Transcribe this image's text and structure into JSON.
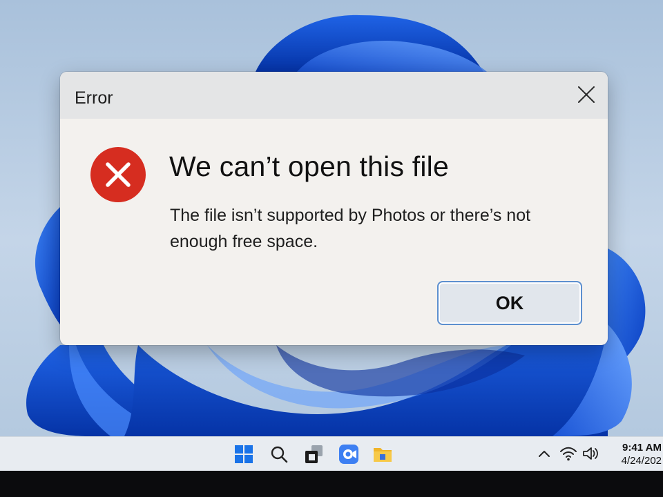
{
  "dialog": {
    "title": "Error",
    "heading": "We can’t open this file",
    "message": "The file isn’t supported by Photos or there’s not enough free space.",
    "ok_label": "OK",
    "icons": {
      "close": "close-icon",
      "status": "error-icon"
    },
    "colors": {
      "error": "#d62d20",
      "button_border": "#5c8fcf"
    }
  },
  "taskbar": {
    "apps": [
      {
        "name": "start",
        "icon": "windows-logo-icon"
      },
      {
        "name": "search",
        "icon": "search-icon"
      },
      {
        "name": "task-view",
        "icon": "task-view-icon"
      },
      {
        "name": "camera-app",
        "icon": "camera-app-icon"
      },
      {
        "name": "file-explorer",
        "icon": "folder-icon"
      }
    ],
    "tray": {
      "icons": [
        "chevron-up-icon",
        "wifi-icon",
        "volume-icon"
      ]
    },
    "clock": {
      "time": "9:41 AM",
      "date": "4/24/202"
    }
  }
}
